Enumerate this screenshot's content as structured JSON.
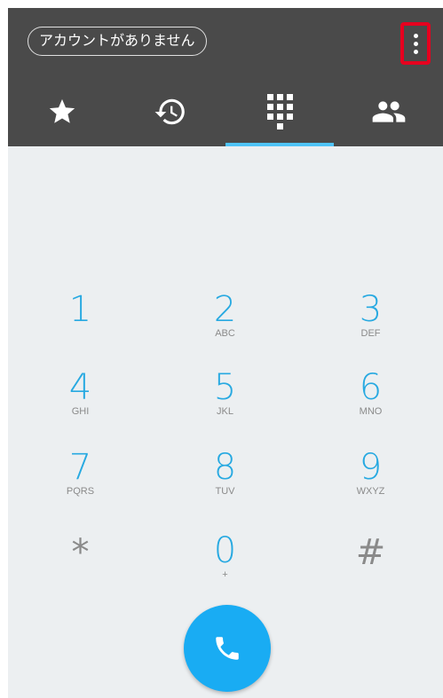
{
  "header": {
    "account_label": "アカウントがありません",
    "more_icon": "more-vert-icon"
  },
  "tabs": [
    {
      "name": "favorites",
      "icon": "star-icon",
      "active": false
    },
    {
      "name": "recents",
      "icon": "history-icon",
      "active": false
    },
    {
      "name": "dialpad",
      "icon": "dialpad-icon",
      "active": true
    },
    {
      "name": "contacts",
      "icon": "people-icon",
      "active": false
    }
  ],
  "keypad": {
    "keys": [
      {
        "digit": "1",
        "letters": ""
      },
      {
        "digit": "2",
        "letters": "ABC"
      },
      {
        "digit": "3",
        "letters": "DEF"
      },
      {
        "digit": "4",
        "letters": "GHI"
      },
      {
        "digit": "5",
        "letters": "JKL"
      },
      {
        "digit": "6",
        "letters": "MNO"
      },
      {
        "digit": "7",
        "letters": "PQRS"
      },
      {
        "digit": "8",
        "letters": "TUV"
      },
      {
        "digit": "9",
        "letters": "WXYZ"
      },
      {
        "digit": "*",
        "letters": ""
      },
      {
        "digit": "0",
        "letters": "+"
      },
      {
        "digit": "#",
        "letters": ""
      }
    ]
  },
  "call_button": {
    "icon": "phone-icon"
  },
  "colors": {
    "appbar": "#4a4a4a",
    "accent": "#27a9e1",
    "tab_indicator": "#4fc3f7",
    "call_button": "#19acf3",
    "highlight": "#e6001f",
    "background": "#eceff1"
  }
}
